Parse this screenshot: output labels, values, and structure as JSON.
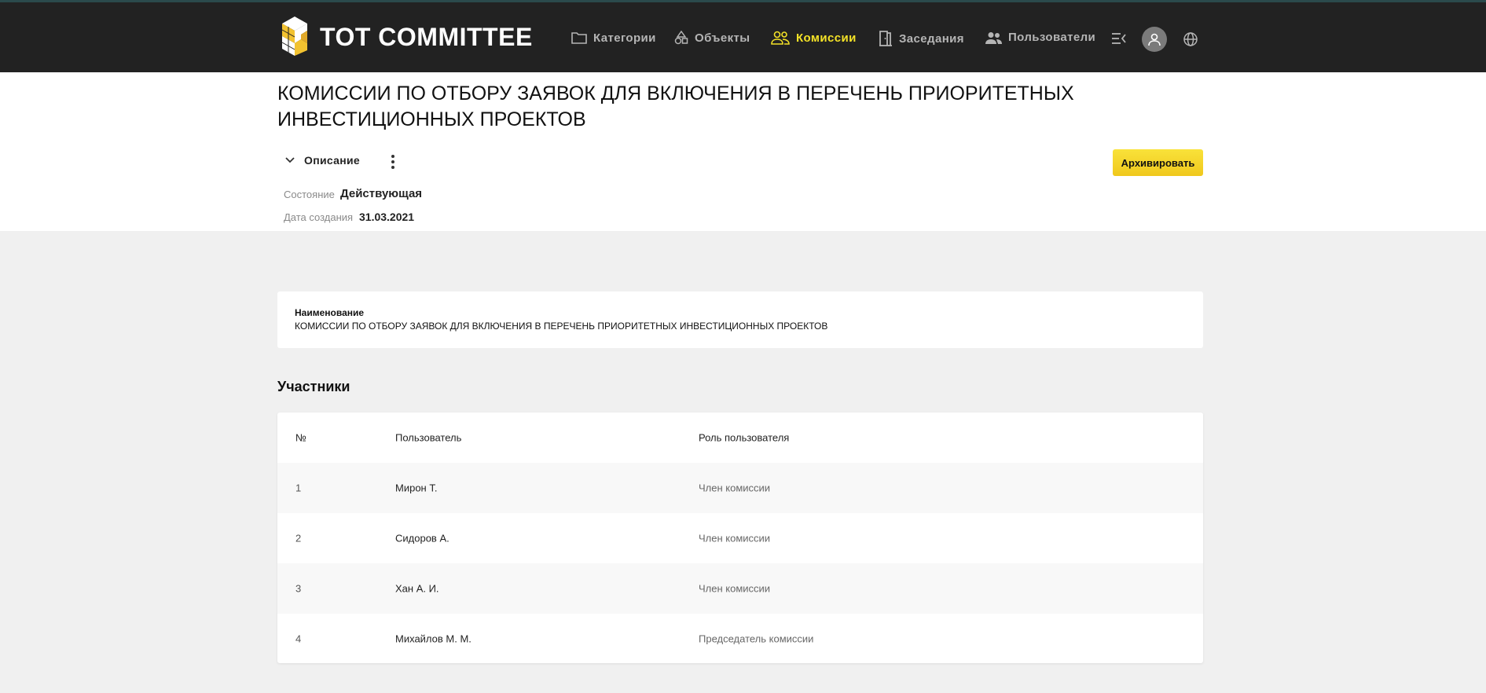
{
  "app": {
    "title": "TOT COMMITTEE"
  },
  "nav": {
    "items": [
      {
        "label": "Категории",
        "icon": "folder-icon",
        "active": false
      },
      {
        "label": "Объекты",
        "icon": "shapes-icon",
        "active": false
      },
      {
        "label": "Комиссии",
        "icon": "group-icon",
        "active": true
      },
      {
        "label": "Заседания",
        "icon": "door-icon",
        "active": false
      },
      {
        "label": "Пользователи",
        "icon": "users-icon",
        "active": false
      }
    ],
    "accent_color": "#f4e227"
  },
  "page": {
    "title": "КОМИССИИ ПО ОТБОРУ ЗАЯВОК ДЛЯ ВКЛЮЧЕНИЯ В ПЕРЕЧЕНЬ ПРИОРИТЕТНЫХ ИНВЕСТИЦИОННЫХ ПРОЕКТОВ",
    "description_toggle": "Описание",
    "archive_button": "Архивировать",
    "state_label": "Состояние",
    "state_value": "Действующая",
    "created_label": "Дата создания",
    "created_value": "31.03.2021"
  },
  "name_card": {
    "label": "Наименование",
    "value": "КОМИССИИ ПО ОТБОРУ ЗАЯВОК ДЛЯ ВКЛЮЧЕНИЯ В ПЕРЕЧЕНЬ ПРИОРИТЕТНЫХ ИНВЕСТИЦИОННЫХ ПРОЕКТОВ"
  },
  "participants": {
    "title": "Участники",
    "columns": [
      "№",
      "Пользователь",
      "Роль пользователя"
    ],
    "rows": [
      {
        "num": "1",
        "user": "Мирон Т.",
        "role": "Член комиссии"
      },
      {
        "num": "2",
        "user": "Сидоров А.",
        "role": "Член комиссии"
      },
      {
        "num": "3",
        "user": "Хан А. И.",
        "role": "Член комиссии"
      },
      {
        "num": "4",
        "user": "Михайлов М. М.",
        "role": "Председатель комиссии"
      }
    ]
  }
}
